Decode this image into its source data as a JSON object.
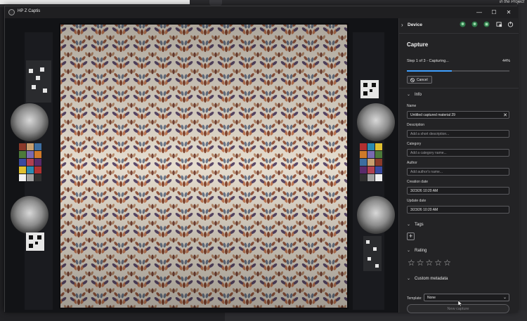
{
  "desktop": {
    "project_text": "in the Project"
  },
  "window": {
    "title": "HP Z Captis",
    "minimize": "—",
    "maximize": "☐",
    "close": "✕"
  },
  "panel": {
    "device_header": "Device",
    "device_icons": [
      "lightbulb-icon",
      "bulb-icon",
      "light-icon",
      "screenshot-icon",
      "power-icon"
    ],
    "capture_title": "Capture",
    "step_text": "Step 1 of 3 - Capturing...",
    "progress_text": "44%",
    "progress_value": 0.44,
    "cancel_label": "Cancel",
    "info_title": "Info",
    "fields": {
      "name_label": "Name",
      "name_value": "Untitled captured material 29",
      "description_label": "Description",
      "description_placeholder": "Add a short description...",
      "category_label": "Category",
      "category_placeholder": "Add a category name...",
      "author_label": "Author",
      "author_placeholder": "Add author's name...",
      "creation_label": "Creation date",
      "creation_value": "3/23/26 10:20 AM",
      "update_label": "Update date",
      "update_value": "3/23/26 10:20 AM"
    },
    "tags_title": "Tags",
    "rating_title": "Rating",
    "rating_value": 0,
    "rating_max": 5,
    "custom_meta_title": "Custom metadata",
    "template_label": "Template:",
    "template_value": "None",
    "new_capture_label": "New capture"
  },
  "colors": {
    "accent": "#3fa0ff",
    "panel_bg": "#232325"
  }
}
